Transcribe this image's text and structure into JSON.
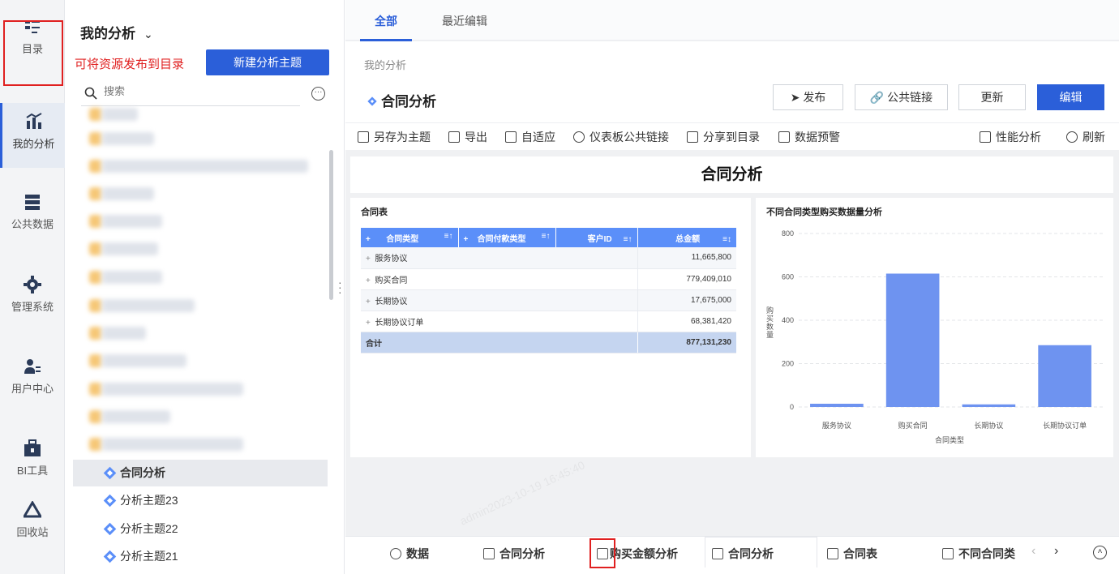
{
  "nav": {
    "catalog": "目录",
    "my_analysis": "我的分析",
    "public_data": "公共数据",
    "manage_system": "管理系统",
    "user_center": "用户中心",
    "bi_tools": "BI工具",
    "recycle_bin": "回收站"
  },
  "sidebar": {
    "title": "我的分析",
    "annotation": "可将资源发布到目录",
    "new_button": "新建分析主题",
    "search_placeholder": "搜索",
    "items": [
      {
        "label": "合同分析"
      },
      {
        "label": "分析主题23"
      },
      {
        "label": "分析主题22"
      },
      {
        "label": "分析主题21"
      }
    ]
  },
  "tabs": {
    "all": "全部",
    "recent": "最近编辑"
  },
  "header": {
    "breadcrumb": "我的分析",
    "title": "合同分析",
    "publish": "发布",
    "public_link": "公共链接",
    "update": "更新",
    "edit": "编辑"
  },
  "toolbar": {
    "save_as": "另存为主题",
    "export": "导出",
    "adaptive": "自适应",
    "dashboard_link": "仪表板公共链接",
    "share_catalog": "分享到目录",
    "data_alert": "数据预警",
    "performance": "性能分析",
    "refresh": "刷新"
  },
  "dashboard": {
    "title": "合同分析",
    "watermark": "admin2023-10-19 16:45:40",
    "table": {
      "title": "合同表",
      "columns": [
        "合同类型",
        "合同付款类型",
        "客户ID",
        "总金额"
      ],
      "rows": [
        {
          "name": "服务协议",
          "amount": "11,665,800"
        },
        {
          "name": "购买合同",
          "amount": "779,409,010"
        },
        {
          "name": "长期协议",
          "amount": "17,675,000"
        },
        {
          "name": "长期协议订单",
          "amount": "68,381,420"
        }
      ],
      "total_label": "合计",
      "total_amount": "877,131,230"
    },
    "chart": {
      "title": "不同合同类型购买数据量分析",
      "ylabel": "购买数量",
      "xlabel": "合同类型"
    }
  },
  "chart_data": {
    "type": "bar",
    "title": "不同合同类型购买数据量分析",
    "categories": [
      "服务协议",
      "购买合同",
      "长期协议",
      "长期协议订单"
    ],
    "values": [
      15,
      615,
      12,
      285
    ],
    "xlabel": "合同类型",
    "ylabel": "购买数量",
    "ylim": [
      0,
      800
    ],
    "yticks": [
      0,
      200,
      400,
      600,
      800
    ],
    "grid": true,
    "color": "#6e93f0"
  },
  "bottom_tabs": {
    "data": "数据",
    "contract_analysis": "合同分析",
    "purchase_amount": "购买金额分析",
    "contract_analysis2": "合同分析",
    "contract_table": "合同表",
    "diff_contract": "不同合同类"
  },
  "colors": {
    "accent": "#2b5fd9",
    "red": "#e02020",
    "bar": "#6e93f0"
  }
}
